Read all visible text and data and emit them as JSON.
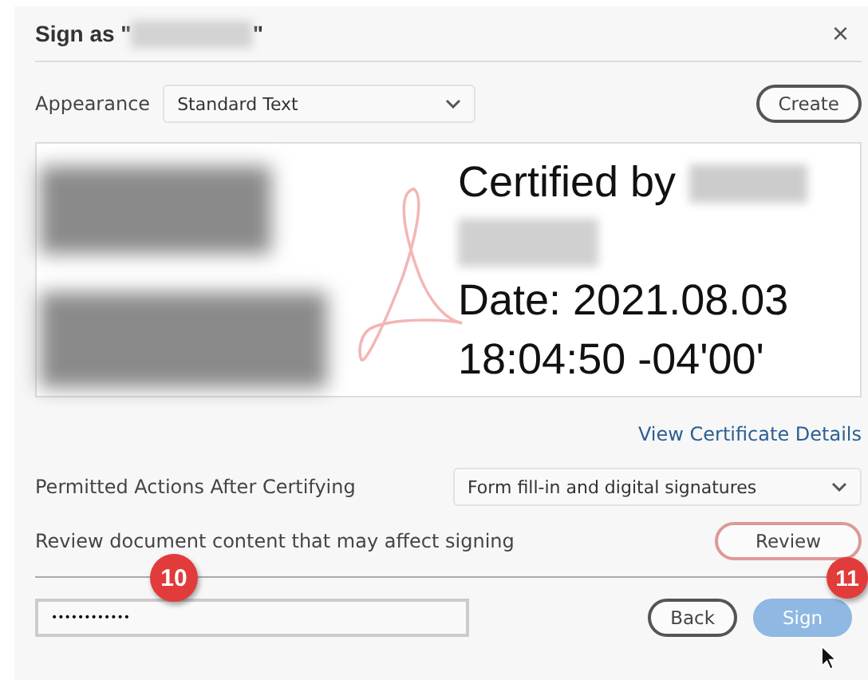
{
  "dialog": {
    "title_prefix": "Sign as \"",
    "title_suffix": "\"",
    "close": "×"
  },
  "appearance": {
    "label": "Appearance",
    "value": "Standard Text",
    "button": "Create"
  },
  "preview": {
    "certified_by": "Certified by",
    "date_line": "Date: 2021.08.03",
    "time_line": "18:04:50 -04'00'"
  },
  "link": "View Certificate Details",
  "permitted": {
    "label": "Permitted Actions After Certifying",
    "value": "Form fill-in and digital signatures"
  },
  "review": {
    "label": "Review document content that may affect signing",
    "button": "Review"
  },
  "password": {
    "value": "••••••••••••"
  },
  "buttons": [
    {
      "label": "Back",
      "kind": "secondary"
    },
    {
      "label": "Sign",
      "kind": "primary"
    }
  ],
  "callouts": [
    "10",
    "11"
  ]
}
